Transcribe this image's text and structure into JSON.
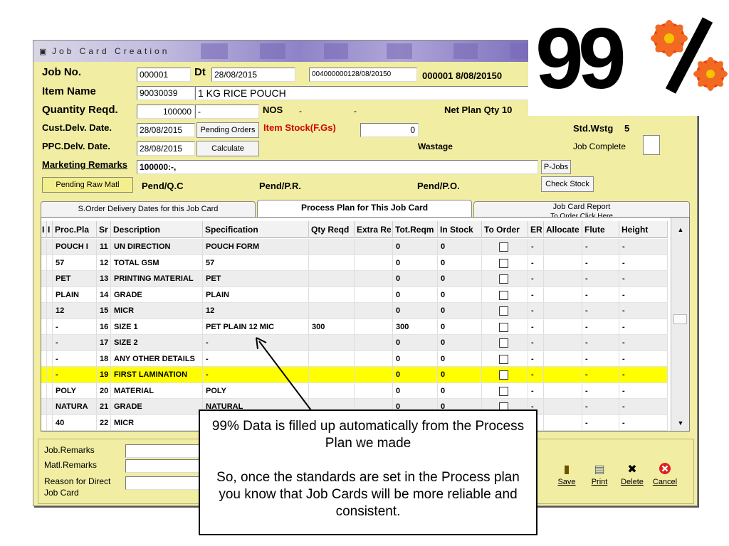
{
  "window": {
    "title": "Job Card Creation"
  },
  "header": {
    "job_no_label": "Job No.",
    "job_no": "000001",
    "dt_label": "Dt",
    "date": "28/08/2015",
    "ref_code": "004000000128/08/20150",
    "job_ref": "000001 8/08/20150",
    "item_name_label": "Item Name",
    "item_code": "90030039",
    "item_desc": "1 KG RICE POUCH",
    "qty_label": "Quantity Reqd.",
    "qty_value": "100000",
    "qty_extra": "-",
    "nos_label": "NOS",
    "dash1": "-",
    "dash2": "-",
    "net_plan_label": "Net Plan Qty 10",
    "cust_delv_label": "Cust.Delv. Date.",
    "cust_delv_date": "28/08/2015",
    "pending_orders_btn": "Pending Orders",
    "item_stock_label": "Item Stock(F.Gs)",
    "item_stock_value": "0",
    "std_wstg_label": "Std.Wstg",
    "std_wstg_value": "5",
    "ppc_delv_label": "PPC.Delv. Date.",
    "ppc_delv_date": "28/08/2015",
    "calculate_btn": "Calculate",
    "wastage_label": "Wastage",
    "job_complete_label": "Job Complete",
    "marketing_label": "Marketing Remarks",
    "marketing_value": "100000:-,",
    "pjobs_btn": "P-Jobs",
    "check_stock_btn": "Check Stock",
    "pending_raw_btn": "Pending Raw Matl",
    "pend_qc": "Pend/Q.C",
    "pend_pr": "Pend/P.R.",
    "pend_po": "Pend/P.O."
  },
  "tabs": [
    {
      "label": "S.Order Delivery Dates for this Job Card"
    },
    {
      "label": "Process Plan for This Job Card"
    },
    {
      "label": "Job Card Report"
    }
  ],
  "tab_subtext": "To Order Click Here",
  "table": {
    "columns": [
      "I",
      "I",
      "Proc.Pla",
      "Sr",
      "Description",
      "Specification",
      "Qty Reqd",
      "Extra Re",
      "Tot.Reqm",
      "In Stock",
      "To Order",
      "ER",
      "Allocate",
      "Flute",
      "Height"
    ],
    "rows": [
      {
        "proc": "POUCH I",
        "sr": "11",
        "desc": "UN DIRECTION",
        "spec": "POUCH FORM",
        "qty": "",
        "tot": "0",
        "stock": "0",
        "er": "-",
        "flute": "-",
        "height": "-"
      },
      {
        "proc": "57",
        "sr": "12",
        "desc": "TOTAL GSM",
        "spec": "57",
        "qty": "",
        "tot": "0",
        "stock": "0",
        "er": "-",
        "flute": "-",
        "height": "-"
      },
      {
        "proc": "PET",
        "sr": "13",
        "desc": "PRINTING MATERIAL",
        "spec": "PET",
        "qty": "",
        "tot": "0",
        "stock": "0",
        "er": "-",
        "flute": "-",
        "height": "-"
      },
      {
        "proc": "PLAIN",
        "sr": "14",
        "desc": "GRADE",
        "spec": "PLAIN",
        "qty": "",
        "tot": "0",
        "stock": "0",
        "er": "-",
        "flute": "-",
        "height": "-"
      },
      {
        "proc": "12",
        "sr": "15",
        "desc": "MICR",
        "spec": "12",
        "qty": "",
        "tot": "0",
        "stock": "0",
        "er": "-",
        "flute": "-",
        "height": "-"
      },
      {
        "proc": "-",
        "sr": "16",
        "desc": "SIZE 1",
        "spec": "PET PLAIN 12 MIC",
        "qty": "300",
        "tot": "300",
        "stock": "0",
        "er": "-",
        "flute": "-",
        "height": "-"
      },
      {
        "proc": "-",
        "sr": "17",
        "desc": "SIZE 2",
        "spec": "-",
        "qty": "",
        "tot": "0",
        "stock": "0",
        "er": "-",
        "flute": "-",
        "height": "-"
      },
      {
        "proc": "-",
        "sr": "18",
        "desc": "ANY OTHER DETAILS",
        "spec": "-",
        "qty": "",
        "tot": "0",
        "stock": "0",
        "er": "-",
        "flute": "-",
        "height": "-"
      },
      {
        "proc": "-",
        "sr": "19",
        "desc": "FIRST LAMINATION",
        "spec": "-",
        "qty": "",
        "tot": "0",
        "stock": "0",
        "er": "-",
        "flute": "-",
        "height": "-"
      },
      {
        "proc": "POLY",
        "sr": "20",
        "desc": "MATERIAL",
        "spec": "POLY",
        "qty": "",
        "tot": "0",
        "stock": "0",
        "er": "-",
        "flute": "-",
        "height": "-"
      },
      {
        "proc": "NATURA",
        "sr": "21",
        "desc": "GRADE",
        "spec": "NATURAL",
        "qty": "",
        "tot": "0",
        "stock": "0",
        "er": "-",
        "flute": "-",
        "height": "-"
      },
      {
        "proc": "40",
        "sr": "22",
        "desc": "MICR",
        "spec": "",
        "qty": "",
        "tot": "",
        "stock": "",
        "er": "",
        "flute": "-",
        "height": "-"
      }
    ],
    "highlight_row": 8
  },
  "bottom": {
    "job_remarks_label": "Job.Remarks",
    "matl_remarks_label": "Matl.Remarks",
    "reason_label_1": "Reason for Direct",
    "reason_label_2": "Job Card",
    "buttons": [
      {
        "label": "Save",
        "icon": "save-icon"
      },
      {
        "label": "Print",
        "icon": "print-icon"
      },
      {
        "label": "Delete",
        "icon": "delete-icon"
      },
      {
        "label": "Cancel",
        "icon": "cancel-icon"
      }
    ]
  },
  "logo": {
    "text": "99%"
  },
  "callout": {
    "line1": "99% Data is filled up automatically from the Process Plan we made",
    "line2": "So, once the standards are set in the Process plan you know that Job Cards will be more reliable and consistent."
  },
  "colors": {
    "panel": "#f1eda2",
    "highlight": "#ffff00",
    "label_red": "#d40000"
  }
}
